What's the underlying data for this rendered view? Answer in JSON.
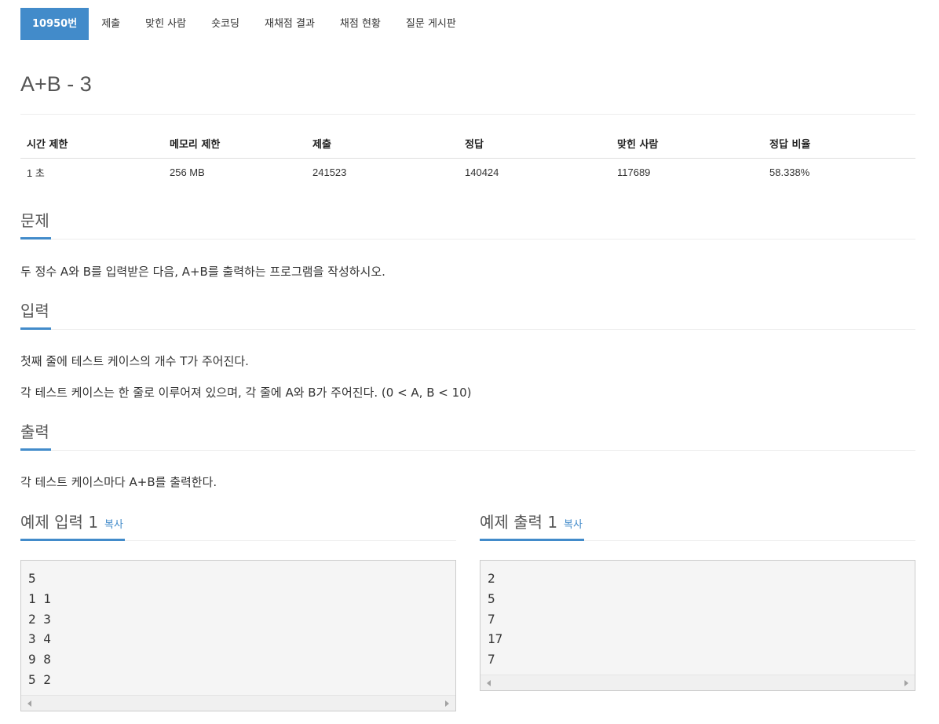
{
  "tabs": [
    {
      "label": "10950번"
    },
    {
      "label": "제출"
    },
    {
      "label": "맞힌 사람"
    },
    {
      "label": "숏코딩"
    },
    {
      "label": "재채점 결과"
    },
    {
      "label": "채점 현황"
    },
    {
      "label": "질문 게시판"
    }
  ],
  "problem": {
    "title": "A+B - 3"
  },
  "info": {
    "headers": [
      "시간 제한",
      "메모리 제한",
      "제출",
      "정답",
      "맞힌 사람",
      "정답 비율"
    ],
    "values": [
      "1 초",
      "256 MB",
      "241523",
      "140424",
      "117689",
      "58.338%"
    ]
  },
  "sections": {
    "description": {
      "heading": "문제",
      "text": "두 정수 A와 B를 입력받은 다음, A+B를 출력하는 프로그램을 작성하시오."
    },
    "input": {
      "heading": "입력",
      "lines": [
        "첫째 줄에 테스트 케이스의 개수 T가 주어진다.",
        "각 테스트 케이스는 한 줄로 이루어져 있으며, 각 줄에 A와 B가 주어진다. (0 < A, B < 10)"
      ]
    },
    "output": {
      "heading": "출력",
      "text": "각 테스트 케이스마다 A+B를 출력한다."
    }
  },
  "samples": {
    "input": {
      "heading": "예제 입력 1",
      "copy_label": "복사",
      "content": "5\n1 1\n2 3\n3 4\n9 8\n5 2"
    },
    "output": {
      "heading": "예제 출력 1",
      "copy_label": "복사",
      "content": "2\n5\n7\n17\n7"
    }
  }
}
